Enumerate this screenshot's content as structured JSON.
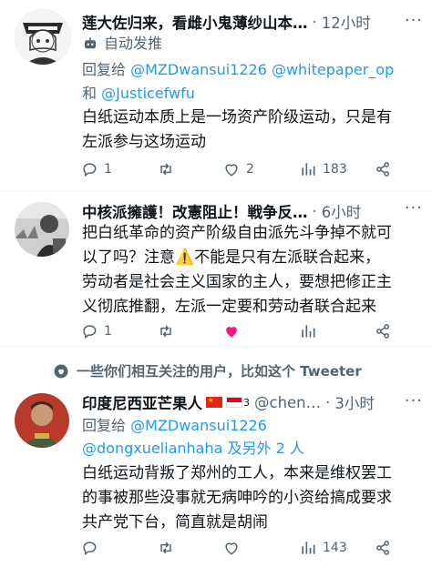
{
  "tweets": [
    {
      "name": "莲大佐归来，看雌小鬼薄纱山本…",
      "dot": "·",
      "time": "12小时",
      "badge": "自动发推",
      "reply_prefix": "回复给",
      "reply_to_1": "@MZDwansui1226 @whitepaper_op",
      "reply_and": "和",
      "reply_to_2": "@Justicefwfu",
      "body_lines": [
        "白纸运动本质上是一场资产阶级运动，只是有",
        "左派参与这场运动"
      ],
      "replies": "1",
      "retweets": "",
      "likes": "2",
      "views": "183"
    },
    {
      "name": "中核派擁護！改憲阻止！戦争反…",
      "dot": "·",
      "time": "6小时",
      "body_lines": [
        "把白纸革命的资产阶级自由派先斗争掉不就可",
        "以了吗？注意",
        "不能是只有左派联合起来，",
        "劳动者是社会主义国家的主人，要想把修正主",
        "义彻底推翻，左派一定要和劳动者联合起来"
      ],
      "replies": "1",
      "retweets": "",
      "likes": "",
      "views": ""
    },
    {
      "name": "印度尼西亚芒果人",
      "superscript": "3",
      "handle": "@chen…",
      "dot": "·",
      "time": "3小时",
      "reply_prefix": "回复给",
      "reply_to_1": "@MZDwansui1226",
      "reply_to_2": "@dongxuelianhaha",
      "reply_others": "及另外 2 人",
      "body_lines": [
        "白纸运动背叛了郑州的工人，本来是维权罢工",
        "的事被那些没事就无病呻吟的小资给搞成要求",
        "共产党下台，简直就是胡闹"
      ],
      "replies": "",
      "retweets": "",
      "likes": "",
      "views": "143"
    }
  ],
  "social_context": "一些你们相互关注的用户，比如这个 Tweeter",
  "more_glyph": "···",
  "warning_glyph": "⚠️",
  "colors": {
    "like_active": "#f91880",
    "link": "#1d9bf0",
    "muted": "#536471"
  }
}
